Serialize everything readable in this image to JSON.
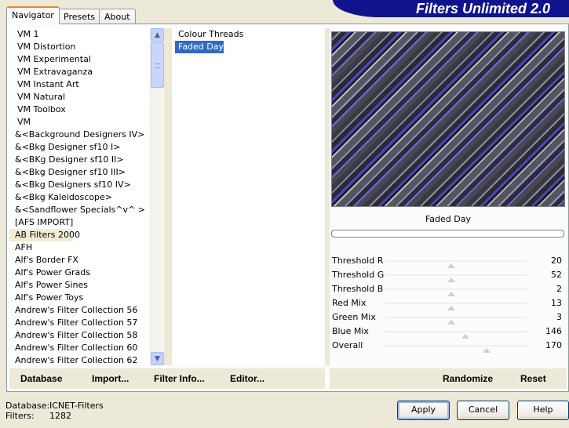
{
  "app": {
    "title": "Filters Unlimited 2.0"
  },
  "tabs": [
    {
      "label": "Navigator",
      "active": true
    },
    {
      "label": "Presets",
      "active": false
    },
    {
      "label": "About",
      "active": false
    }
  ],
  "categories": {
    "selected": "AB Filters 2000",
    "items": [
      "VM 1",
      "VM Distortion",
      "VM Experimental",
      "VM Extravaganza",
      "VM Instant Art",
      "VM Natural",
      "VM Toolbox",
      "VM",
      "&<Background Designers IV>",
      "&<Bkg Designer sf10 I>",
      "&<BKg Designer sf10 II>",
      "&<Bkg Designer sf10 III>",
      "&<Bkg Designers sf10 IV>",
      "&<Bkg Kaleidoscope>",
      "&<Sandflower Specials^v^ >",
      "[AFS IMPORT]",
      "AB Filters 2000",
      "AFH",
      "Alf's Border FX",
      "Alf's Power Grads",
      "Alf's Power Sines",
      "Alf's Power Toys",
      "Andrew's Filter Collection 56",
      "Andrew's Filter Collection 57",
      "Andrew's Filter Collection 58",
      "Andrew's Filter Collection 60",
      "Andrew's Filter Collection 62"
    ]
  },
  "filters": {
    "selected": "Faded Day",
    "items": [
      "Colour Threads",
      "Faded Day"
    ]
  },
  "preview": {
    "filter_name": "Faded Day",
    "colors": [
      "#3a3a45",
      "#4c48b8",
      "#8c8ca3",
      "#b9b9cc"
    ]
  },
  "params": [
    {
      "label": "Threshold R",
      "value": 20
    },
    {
      "label": "Threshold G",
      "value": 52
    },
    {
      "label": "Threshold B",
      "value": 2
    },
    {
      "label": "Red Mix",
      "value": 13
    },
    {
      "label": "Green Mix",
      "value": 3
    },
    {
      "label": "Blue Mix",
      "value": 146
    },
    {
      "label": "Overall",
      "value": 170
    }
  ],
  "toolbar": {
    "database": "Database",
    "import": "Import...",
    "filter_info": "Filter Info...",
    "editor": "Editor...",
    "randomize": "Randomize",
    "reset": "Reset"
  },
  "status": {
    "database_label": "Database:",
    "database_value": "ICNET-Filters",
    "filters_label": "Filters:",
    "filters_value": "1282"
  },
  "dialog": {
    "apply": "Apply",
    "cancel": "Cancel",
    "help": "Help"
  }
}
